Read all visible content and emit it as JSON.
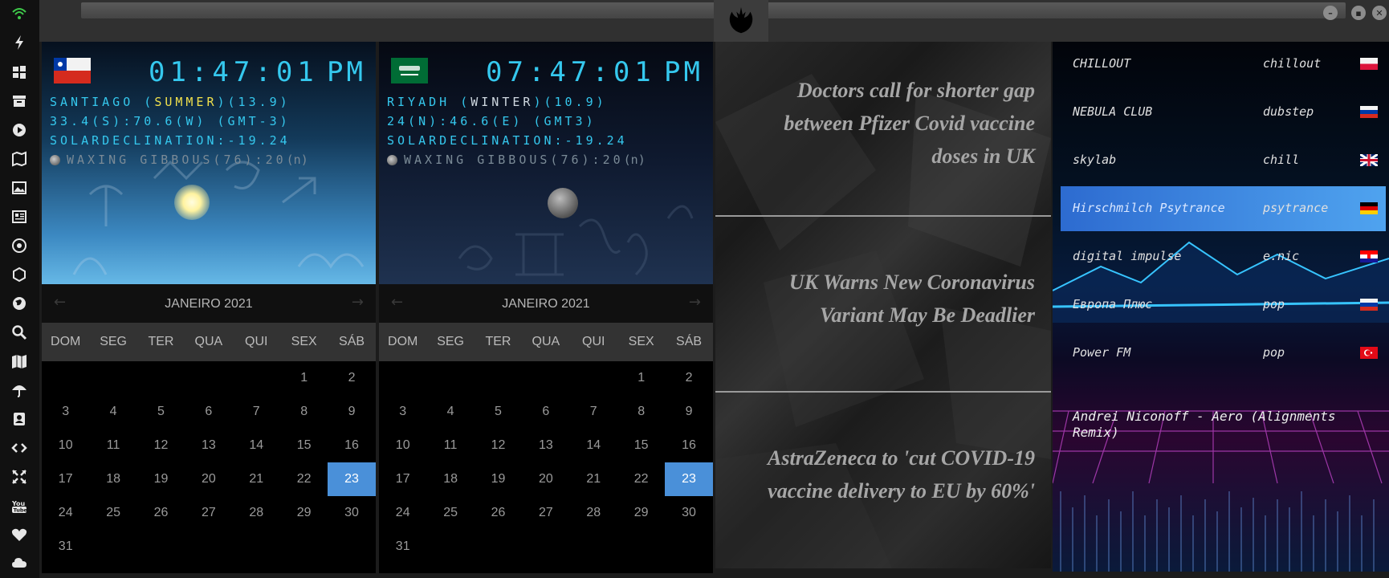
{
  "sidebar": {
    "icons": [
      "wifi-icon",
      "bolt-icon",
      "windows-icon",
      "archive-icon",
      "play-icon",
      "map-fold-icon",
      "image-icon",
      "newspaper-icon",
      "rebel-icon",
      "hexagon-icon",
      "globe-icon",
      "search-icon",
      "map-icon",
      "umbrella-icon",
      "contacts-icon",
      "code-icon",
      "expand-icon",
      "youtube-icon",
      "heart-icon",
      "cloud-icon"
    ]
  },
  "topbar": {
    "logo": "rebel-alliance-logo"
  },
  "clocks": [
    {
      "time": "01:47:01",
      "ampm": "PM",
      "city_line_pre": "SANTIAGO (",
      "season": "SUMMER",
      "city_line_post": ")(13.9)",
      "coords": "33.4(S):70.6(W) (GMT-3)",
      "declination": "SOLARDECLINATION:-19.24",
      "moon_phase": "WAXING GIBBOUS(76):20",
      "moon_suffix": "(n)"
    },
    {
      "time": "07:47:01",
      "ampm": "PM",
      "city_line_pre": "RIYADH (",
      "season": "WINTER",
      "city_line_post": ")(10.9)",
      "coords": "24(N):46.6(E) (GMT3)",
      "declination": "SOLARDECLINATION:-19.24",
      "moon_phase": "WAXING GIBBOUS(76):20",
      "moon_suffix": "(n)"
    }
  ],
  "calendars": [
    {
      "title": "JANEIRO 2021",
      "prev": "←",
      "next": "→"
    },
    {
      "title": "JANEIRO 2021",
      "prev": "←",
      "next": "→"
    }
  ],
  "calendar_days": [
    "DOM",
    "SEG",
    "TER",
    "QUA",
    "QUI",
    "SEX",
    "SÁB"
  ],
  "calendar_weeks": [
    [
      "",
      "",
      "",
      "",
      "",
      "1",
      "2"
    ],
    [
      "3",
      "4",
      "5",
      "6",
      "7",
      "8",
      "9"
    ],
    [
      "10",
      "11",
      "12",
      "13",
      "14",
      "15",
      "16"
    ],
    [
      "17",
      "18",
      "19",
      "20",
      "21",
      "22",
      "23"
    ],
    [
      "24",
      "25",
      "26",
      "27",
      "28",
      "29",
      "30"
    ],
    [
      "31",
      "",
      "",
      "",
      "",
      "",
      ""
    ]
  ],
  "calendar_selected": "23",
  "news": [
    {
      "line1": "Doctors call for shorter gap",
      "line2": "between Pfizer Covid vaccine",
      "line3": "doses in UK"
    },
    {
      "line1": "UK Warns New Coronavirus",
      "line2": "Variant May Be Deadlier"
    },
    {
      "line1": "AstraZeneca to 'cut COVID-19",
      "line2": "vaccine delivery to EU by 60%'"
    }
  ],
  "radio": {
    "stations": [
      {
        "name": "CHILLOUT",
        "genre": "chillout",
        "flag": "PL"
      },
      {
        "name": "NEBULA CLUB",
        "genre": "dubstep",
        "flag": "RU"
      },
      {
        "name": "skylab",
        "genre": "chill",
        "flag": "GB"
      },
      {
        "name": "Hirschmilch Psytrance",
        "genre": "psytrance",
        "flag": "DE"
      },
      {
        "name": "digital impulse",
        "genre": "e.nic",
        "flag": "HR"
      },
      {
        "name": "Европа Плюс",
        "genre": "pop",
        "flag": "RU"
      },
      {
        "name": "Power FM",
        "genre": "pop",
        "flag": "TR"
      }
    ],
    "now_playing": "Andrei Niconoff - Aero (Alignments Remix)"
  },
  "colors": {
    "accent": "#35c8ee",
    "selected_day": "#4a90d9",
    "active_station": "#3b86e0"
  }
}
